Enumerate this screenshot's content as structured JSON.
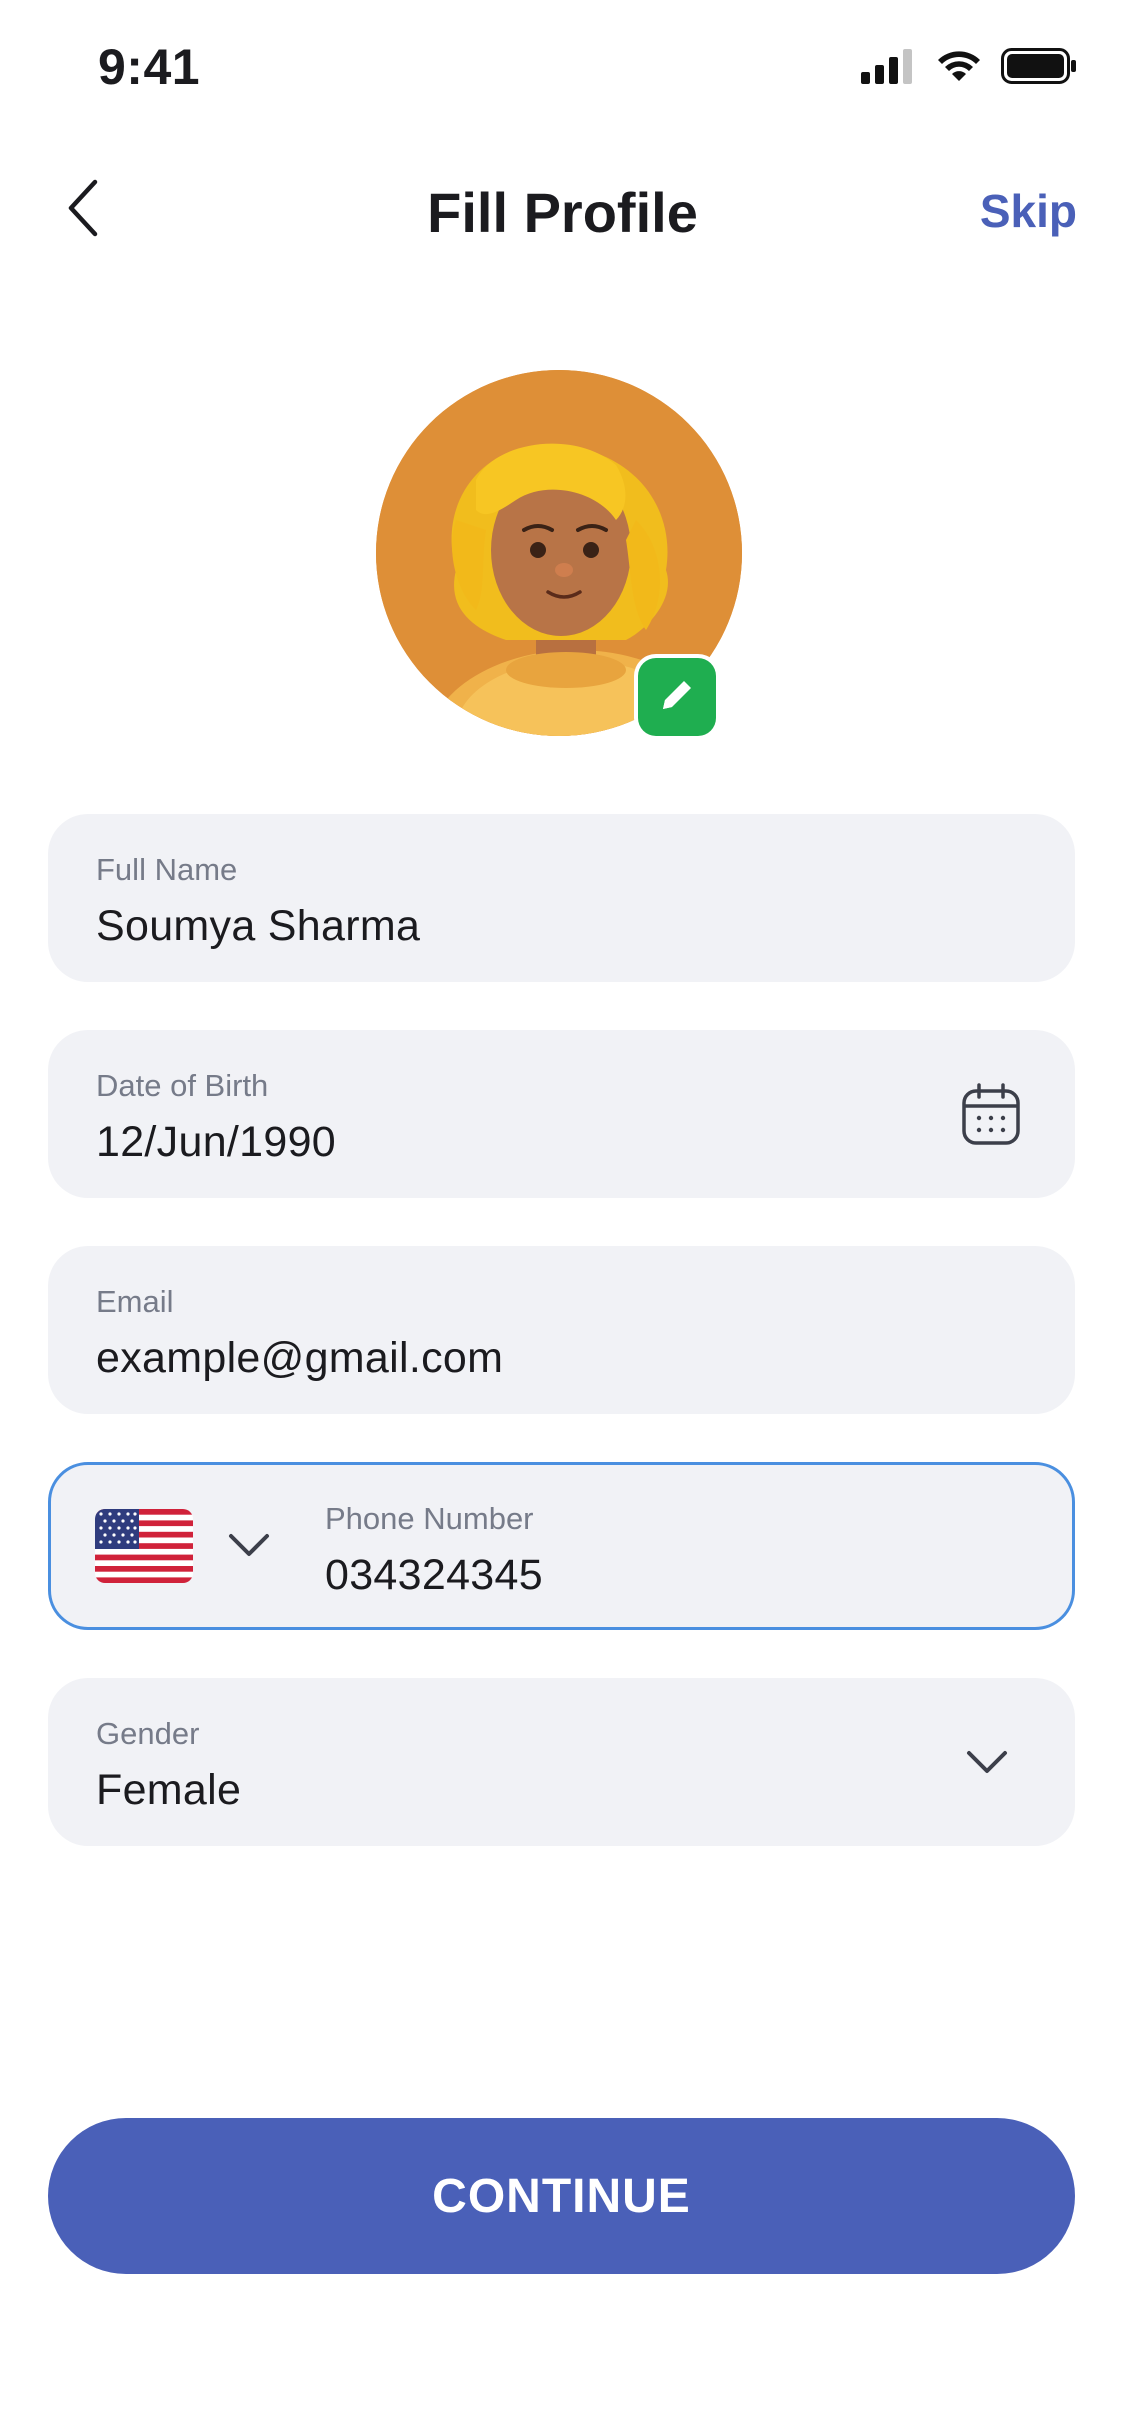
{
  "status_bar": {
    "time": "9:41",
    "icons": [
      "signal-icon",
      "wifi-icon",
      "battery-icon"
    ]
  },
  "header": {
    "back_icon": "chevron-left-icon",
    "title": "Fill Profile",
    "skip_label": "Skip"
  },
  "profile": {
    "avatar": "avatar-image",
    "edit_icon": "pencil-icon"
  },
  "form": {
    "full_name": {
      "label": "Full Name",
      "value": "Soumya Sharma"
    },
    "date_of_birth": {
      "label": "Date of Birth",
      "value": "12/Jun/1990",
      "icon": "calendar-icon"
    },
    "email": {
      "label": "Email",
      "value": "example@gmail.com"
    },
    "phone": {
      "label": "Phone Number",
      "value": "034324345",
      "country_flag": "us-flag-icon",
      "country_icon": "chevron-down-icon"
    },
    "gender": {
      "label": "Gender",
      "value": "Female",
      "icon": "chevron-down-icon"
    }
  },
  "continue_label": "CONTINUE",
  "colors": {
    "accent": "#4a60b8",
    "field_bg": "#f1f2f6",
    "focus_border": "#4a8fe0",
    "edit_badge": "#1fae50",
    "avatar_bg": "#de8f37"
  }
}
